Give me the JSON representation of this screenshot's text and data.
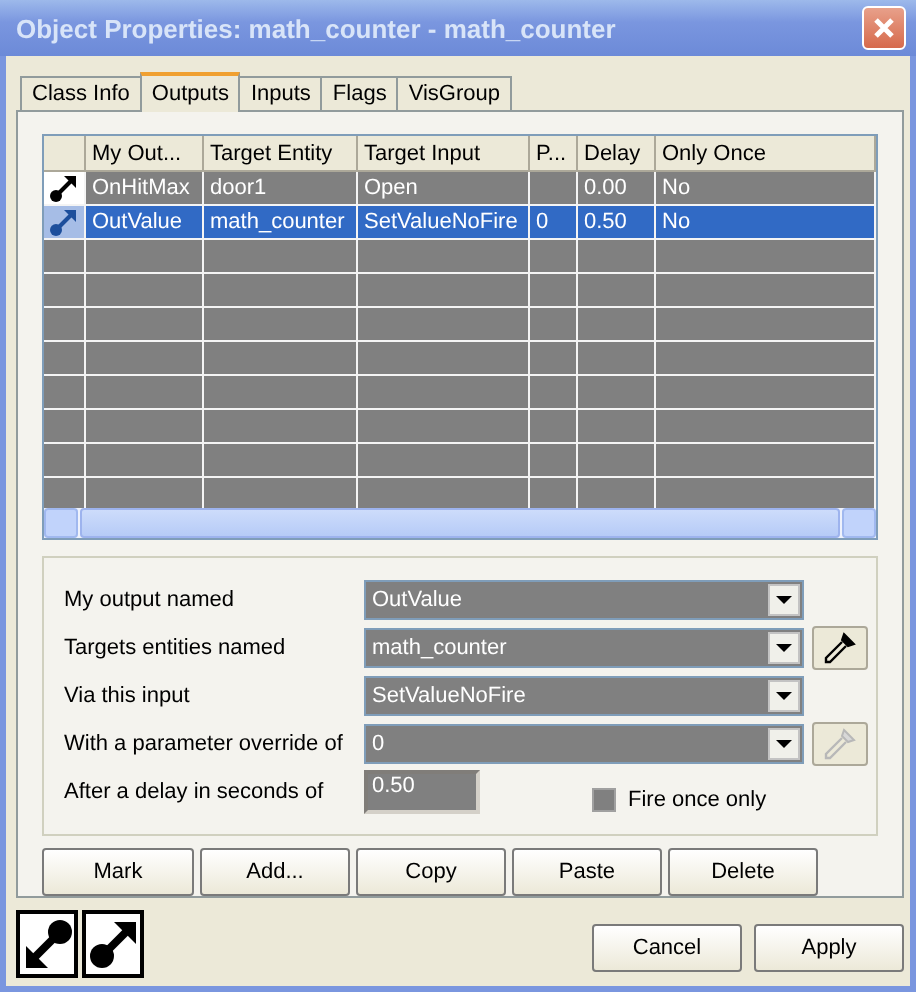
{
  "window": {
    "title": "Object Properties: math_counter - math_counter"
  },
  "tabs": [
    {
      "label": "Class Info",
      "selected": false
    },
    {
      "label": "Outputs",
      "selected": true
    },
    {
      "label": "Inputs",
      "selected": false
    },
    {
      "label": "Flags",
      "selected": false
    },
    {
      "label": "VisGroup",
      "selected": false
    }
  ],
  "outputs_table": {
    "columns": [
      "My Out...",
      "Target Entity",
      "Target Input",
      "P...",
      "Delay",
      "Only Once"
    ],
    "rows": [
      {
        "selected": false,
        "my_output": "OnHitMax",
        "target_entity": "door1",
        "target_input": "Open",
        "delay": "0.00",
        "only_once": "No"
      },
      {
        "selected": true,
        "my_output": "OutValue",
        "target_entity": "math_counter",
        "target_input": "SetValueNoFire",
        "parameter": "0",
        "delay": "0.50",
        "only_once": "No"
      }
    ]
  },
  "form": {
    "fields": [
      {
        "label": "My output named",
        "kind": "dropdown",
        "value": "OutValue",
        "picker": false
      },
      {
        "label": "Targets entities named",
        "kind": "dropdown",
        "value": "math_counter",
        "picker": true,
        "picker_disabled": false
      },
      {
        "label": "Via this input",
        "kind": "dropdown",
        "value": "SetValueNoFire",
        "picker": false
      },
      {
        "label": "With a parameter override of",
        "kind": "dropdown",
        "value": "0",
        "picker": true,
        "picker_disabled": true
      },
      {
        "label": "After a delay in seconds of",
        "kind": "text",
        "value": "0.50"
      }
    ],
    "fire_once": {
      "label": "Fire once only",
      "checked": false,
      "disabled": true
    }
  },
  "actions": [
    "Mark",
    "Add...",
    "Copy",
    "Paste",
    "Delete"
  ],
  "footer": {
    "buttons": [
      "Cancel",
      "Apply"
    ]
  }
}
